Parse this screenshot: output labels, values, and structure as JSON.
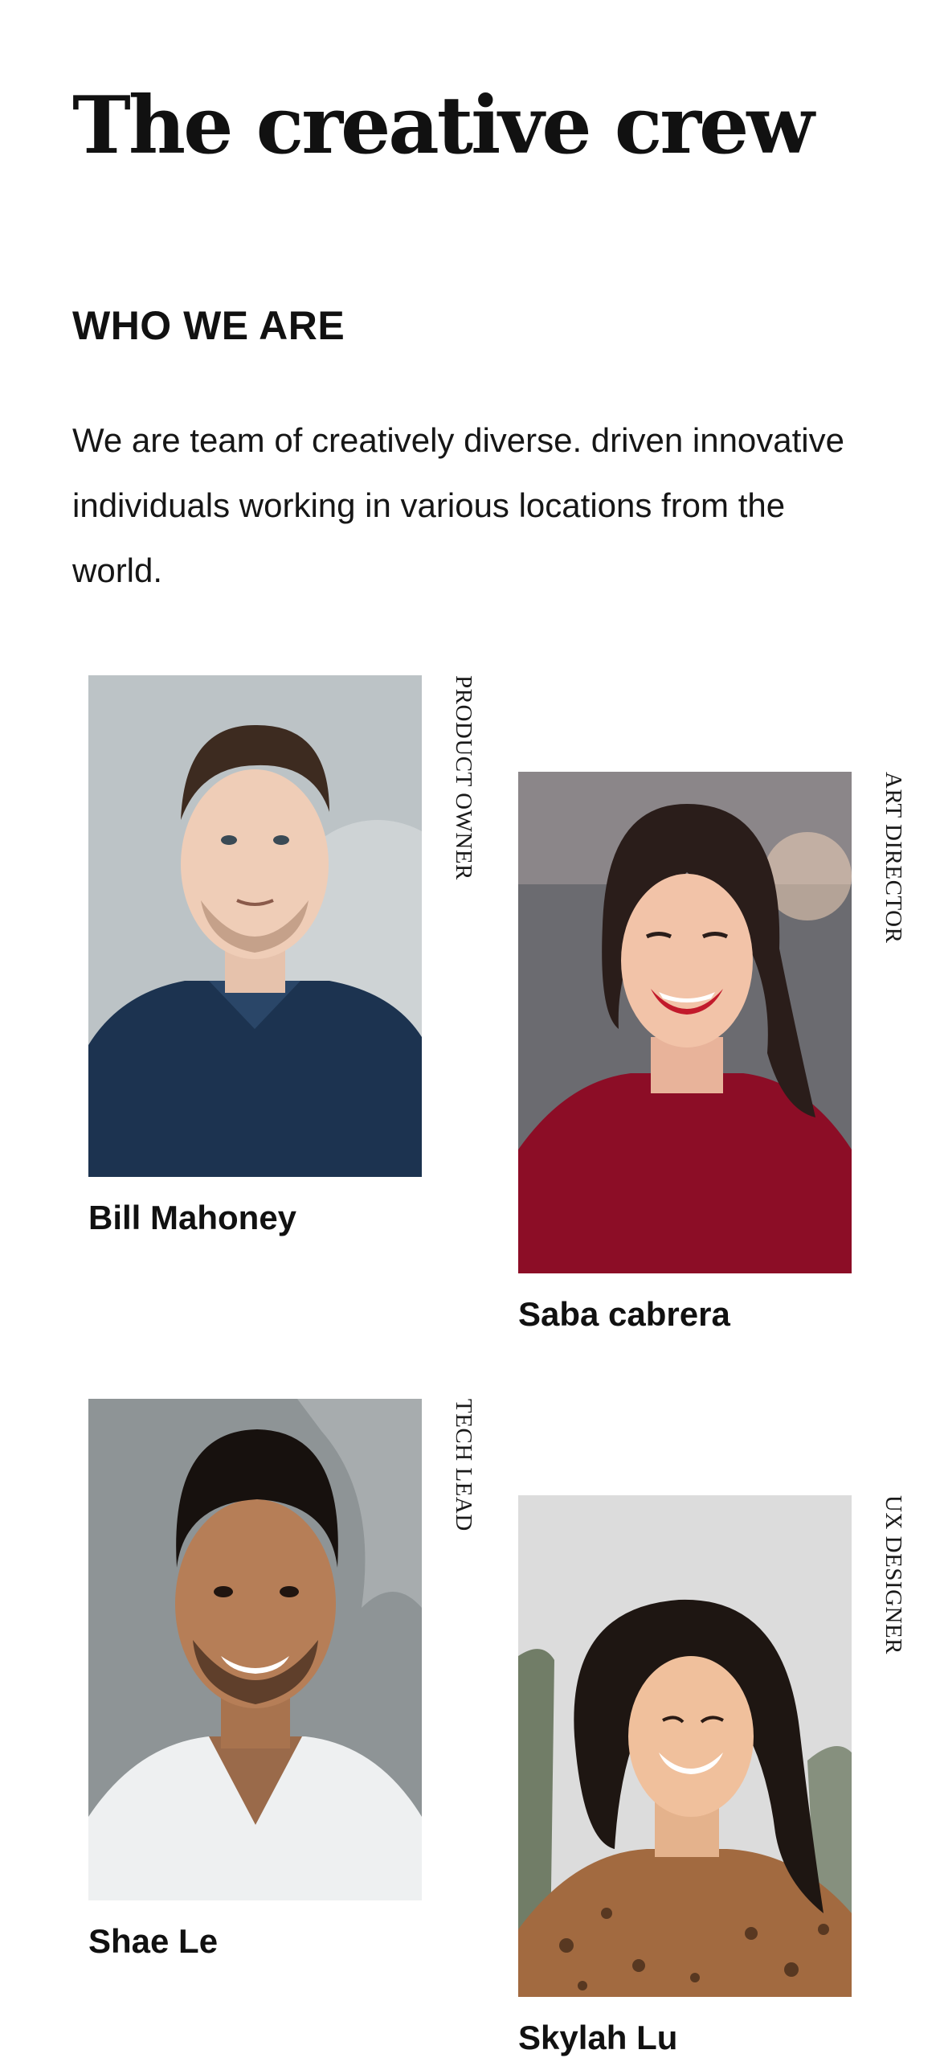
{
  "page": {
    "title": "The creative crew",
    "section_heading": "WHO WE ARE",
    "intro": "We are team of creatively diverse. driven innovative individuals working in various locations from the world."
  },
  "team": [
    {
      "name": "Bill Mahoney",
      "role": "PRODUCT OWNER"
    },
    {
      "name": "Saba cabrera",
      "role": "ART DIRECTOR"
    },
    {
      "name": "Shae Le",
      "role": "TECH LEAD"
    },
    {
      "name": "Skylah Lu",
      "role": "UX DESIGNER"
    }
  ],
  "colors": {
    "text": "#111111",
    "background": "#ffffff"
  }
}
